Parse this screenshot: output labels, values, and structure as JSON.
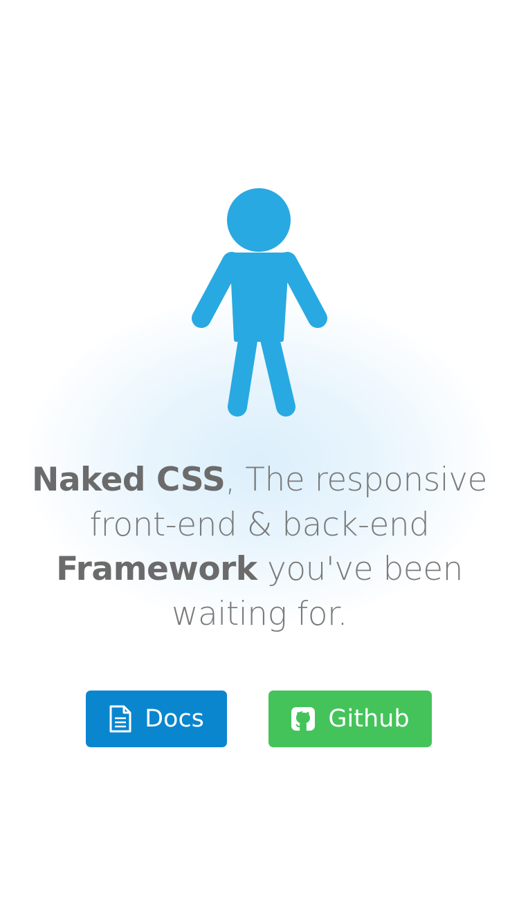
{
  "hero": {
    "figure_color": "#29a9e1"
  },
  "tagline": {
    "brand": "Naked CSS",
    "part1": ", The responsive front-end & back-end ",
    "emphasis": "Framework",
    "part2": " you've been waiting for."
  },
  "buttons": {
    "docs": {
      "label": "Docs",
      "icon": "document-icon",
      "color": "#0a86cf"
    },
    "github": {
      "label": "Github",
      "icon": "github-icon",
      "color": "#44c35a"
    }
  }
}
